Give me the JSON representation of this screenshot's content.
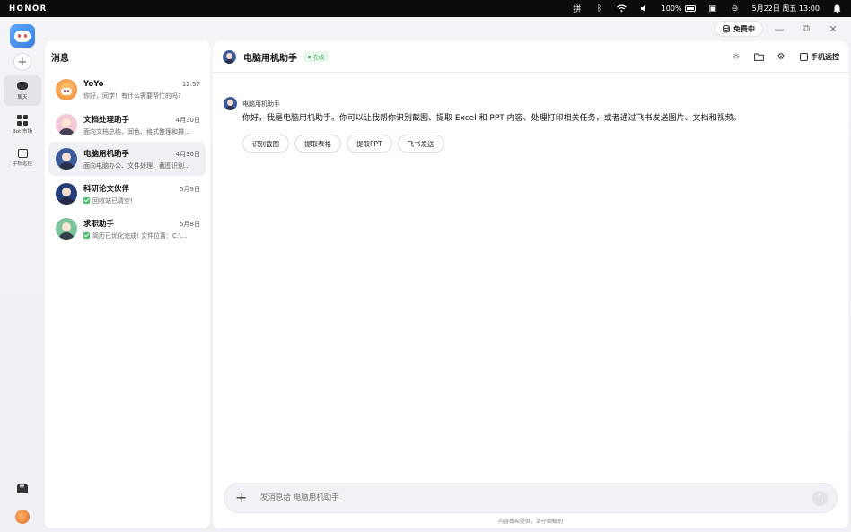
{
  "system_bar": {
    "brand": "HONOR",
    "battery": "100%",
    "datetime": "5月22日 周五 13:00"
  },
  "window": {
    "free_badge": "免费中"
  },
  "rail": {
    "items": [
      {
        "label": "聊天",
        "icon": "chat-bubble-icon"
      },
      {
        "label": "Bot 市场",
        "icon": "grid-icon"
      },
      {
        "label": "手机远控",
        "icon": "phone-remote-icon"
      }
    ]
  },
  "list": {
    "title": "消息",
    "conversations": [
      {
        "name": "YoYo",
        "time": "12:57",
        "preview": "你好，同学！有什么需要帮忙的吗?",
        "check": false
      },
      {
        "name": "文档处理助手",
        "time": "4月30日",
        "preview": "面向文档总结、润色、格式整理和排...",
        "check": false
      },
      {
        "name": "电脑用机助手",
        "time": "4月30日",
        "preview": "面向电脑办公、文件处理、截图识别...",
        "check": false
      },
      {
        "name": "科研论文伙伴",
        "time": "5月9日",
        "preview": "回收站已清空!",
        "check": true
      },
      {
        "name": "求职助手",
        "time": "5月8日",
        "preview": "简历已优化完成! 文件位置：C:\\...",
        "check": true
      }
    ]
  },
  "chat": {
    "title": "电脑用机助手",
    "status": "在线",
    "remote_label": "手机远控",
    "sender": "电脑用机助手",
    "message": "你好，我是电脑用机助手。你可以让我帮你识别截图、提取 Excel 和 PPT 内容、处理打印相关任务，或者通过飞书发送图片、文档和视频。",
    "chips": [
      "识别截图",
      "提取表格",
      "提取PPT",
      "飞书发送"
    ],
    "input_placeholder": "发消息给 电脑用机助手",
    "disclaimer": "内容由AI提供，请仔细甄别"
  }
}
